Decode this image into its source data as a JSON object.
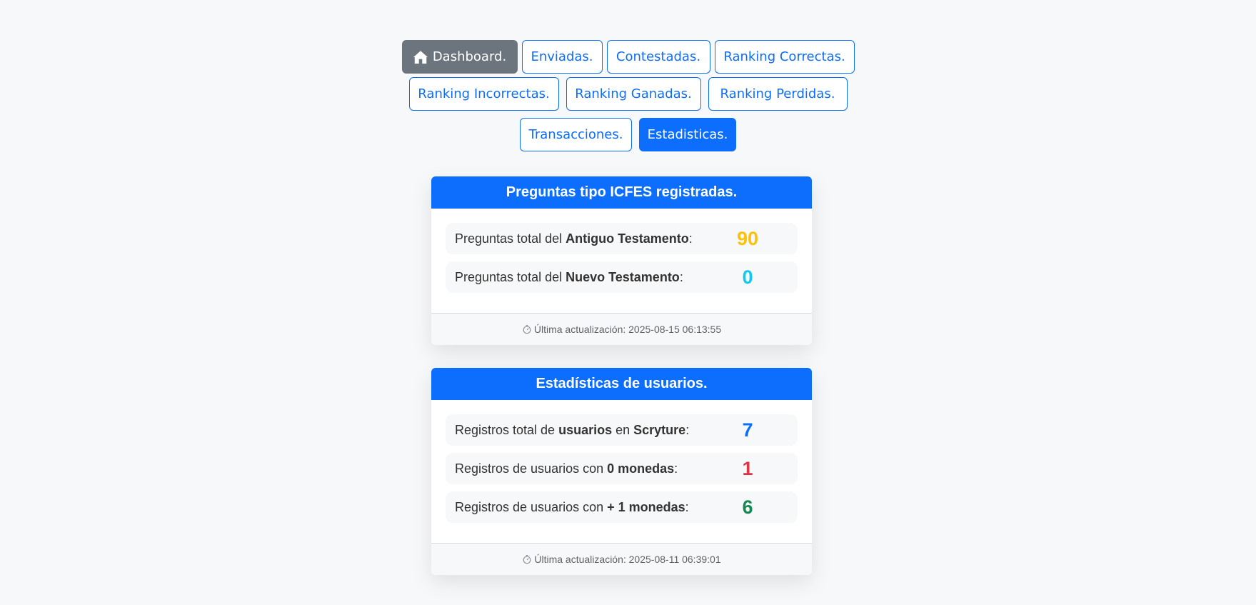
{
  "nav": {
    "dashboard": "Dashboard.",
    "enviadas": "Enviadas.",
    "contestadas": "Contestadas.",
    "ranking_correctas": "Ranking Correctas.",
    "ranking_incorrectas": "Ranking Incorrectas.",
    "ranking_ganadas": "Ranking Ganadas.",
    "ranking_perdidas": "Ranking Perdidas.",
    "transacciones": "Transacciones.",
    "estadisticas": "Estadisticas."
  },
  "icons": {
    "dashboard": "home-icon",
    "footer": "stopwatch-icon"
  },
  "preguntas_card": {
    "title": "Preguntas tipo ICFES registradas.",
    "rows": [
      {
        "prefix": "Preguntas total del ",
        "bold": "Antiguo Testamento",
        "suffix": ":",
        "value": "90",
        "color": "#ffc107"
      },
      {
        "prefix": "Preguntas total del ",
        "bold": "Nuevo Testamento",
        "suffix": ":",
        "value": "0",
        "color": "#0dcaf0"
      }
    ],
    "footer": "Última actualización: 2025-08-15 06:13:55"
  },
  "usuarios_card": {
    "title": "Estadísticas de usuarios.",
    "rows": [
      {
        "prefix": "Registros total de ",
        "bold": "usuarios",
        "middle": " en ",
        "bold2": "Scryture",
        "suffix": ":",
        "value": "7",
        "color": "#0d6efd"
      },
      {
        "prefix": "Registros de usuarios con ",
        "bold": "0 monedas",
        "suffix": ":",
        "value": "1",
        "color": "#dc3545"
      },
      {
        "prefix": "Registros de usuarios con ",
        "bold": "+ 1 monedas",
        "suffix": ":",
        "value": "6",
        "color": "#198754"
      }
    ],
    "footer": "Última actualización: 2025-08-11 06:39:01"
  },
  "colors": {
    "primary": "#0d6efd",
    "secondary": "#6c757d",
    "background": "#f7f8fa"
  }
}
